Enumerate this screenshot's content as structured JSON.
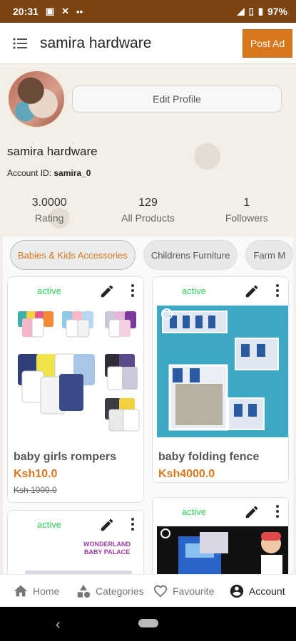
{
  "status_bar": {
    "time": "20:31",
    "battery": "97%"
  },
  "app_bar": {
    "title": "samira hardware",
    "post_ad_label": "Post Ad"
  },
  "profile": {
    "edit_label": "Edit Profile",
    "shop_name": "samira hardware",
    "account_id_label": "Account ID:",
    "account_id": "samira_0"
  },
  "stats": [
    {
      "value": "3.0000",
      "label": "Rating"
    },
    {
      "value": "129",
      "label": "All Products"
    },
    {
      "value": "1",
      "label": "Followers"
    }
  ],
  "categories": [
    "Babies & Kids Accessories",
    "Childrens Furniture",
    "Farm M"
  ],
  "products": [
    {
      "status": "active",
      "name": "baby girls rompers",
      "price": "Ksh10.0",
      "old_price": "Ksh 1000.0"
    },
    {
      "status": "active",
      "name": "baby folding fence",
      "price": "Ksh4000.0"
    },
    {
      "status": "active",
      "image_text_1": "WONDERLAND",
      "image_text_2": "BABY PALACE"
    },
    {
      "status": "active"
    }
  ],
  "bottom_nav": [
    {
      "label": "Home",
      "icon": "home-icon"
    },
    {
      "label": "Categories",
      "icon": "categories-icon"
    },
    {
      "label": "Favourite",
      "icon": "heart-icon"
    },
    {
      "label": "Account",
      "icon": "account-icon",
      "active": true
    }
  ],
  "colors": {
    "brand": "#d9771c",
    "status_bar": "#7a4310",
    "active_status": "#2dd25a"
  }
}
